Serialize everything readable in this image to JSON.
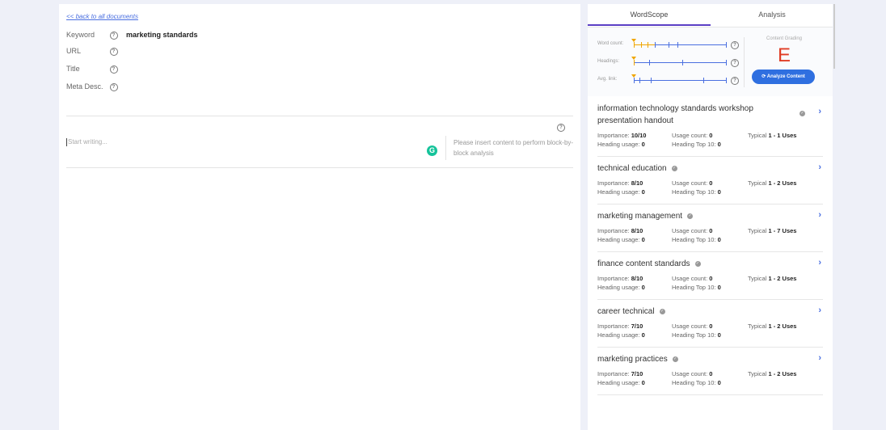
{
  "editor": {
    "back_link": "<< back to all documents",
    "fields": [
      {
        "label": "Keyword",
        "value": "marketing standards"
      },
      {
        "label": "URL",
        "value": ""
      },
      {
        "label": "Title",
        "value": ""
      },
      {
        "label": "Meta Desc.",
        "value": ""
      }
    ],
    "help_glyph": "?",
    "write_placeholder": "Start writing...",
    "grammarly_glyph": "G",
    "block_hint": "Please insert content to perform block-by-block analysis"
  },
  "panel": {
    "tabs": [
      {
        "label": "WordScope",
        "active": true
      },
      {
        "label": "Analysis",
        "active": false
      }
    ],
    "metrics": [
      {
        "label": "Word count:"
      },
      {
        "label": "Headings:"
      },
      {
        "label": "Avg. link:"
      }
    ],
    "content_grading_label": "Content Grading",
    "grade": "E",
    "analyze_button": "Analyze Content",
    "labels": {
      "importance": "Importance:",
      "usage_count": "Usage count:",
      "typical": "Typical",
      "heading_usage": "Heading usage:",
      "heading_top10": "Heading Top 10:"
    },
    "topics": [
      {
        "title": "information technology standards workshop presentation handout",
        "importance": "10/10",
        "usage_count": "0",
        "typical": "1 - 1 Uses",
        "heading_usage": "0",
        "heading_top10": "0"
      },
      {
        "title": "technical education",
        "importance": "8/10",
        "usage_count": "0",
        "typical": "1 - 2 Uses",
        "heading_usage": "0",
        "heading_top10": "0"
      },
      {
        "title": "marketing management",
        "importance": "8/10",
        "usage_count": "0",
        "typical": "1 - 7 Uses",
        "heading_usage": "0",
        "heading_top10": "0"
      },
      {
        "title": "finance content standards",
        "importance": "8/10",
        "usage_count": "0",
        "typical": "1 - 2 Uses",
        "heading_usage": "0",
        "heading_top10": "0"
      },
      {
        "title": "career technical",
        "importance": "7/10",
        "usage_count": "0",
        "typical": "1 - 2 Uses",
        "heading_usage": "0",
        "heading_top10": "0"
      },
      {
        "title": "marketing practices",
        "importance": "7/10",
        "usage_count": "0",
        "typical": "1 - 2 Uses",
        "heading_usage": "0",
        "heading_top10": "0"
      }
    ]
  },
  "colors": {
    "accent": "#4a6fe0",
    "tab_underline": "#5b3fc5",
    "grade": "#e03d25",
    "button": "#2f6fe0",
    "marker": "#f0a500",
    "grammarly": "#15c39a"
  }
}
